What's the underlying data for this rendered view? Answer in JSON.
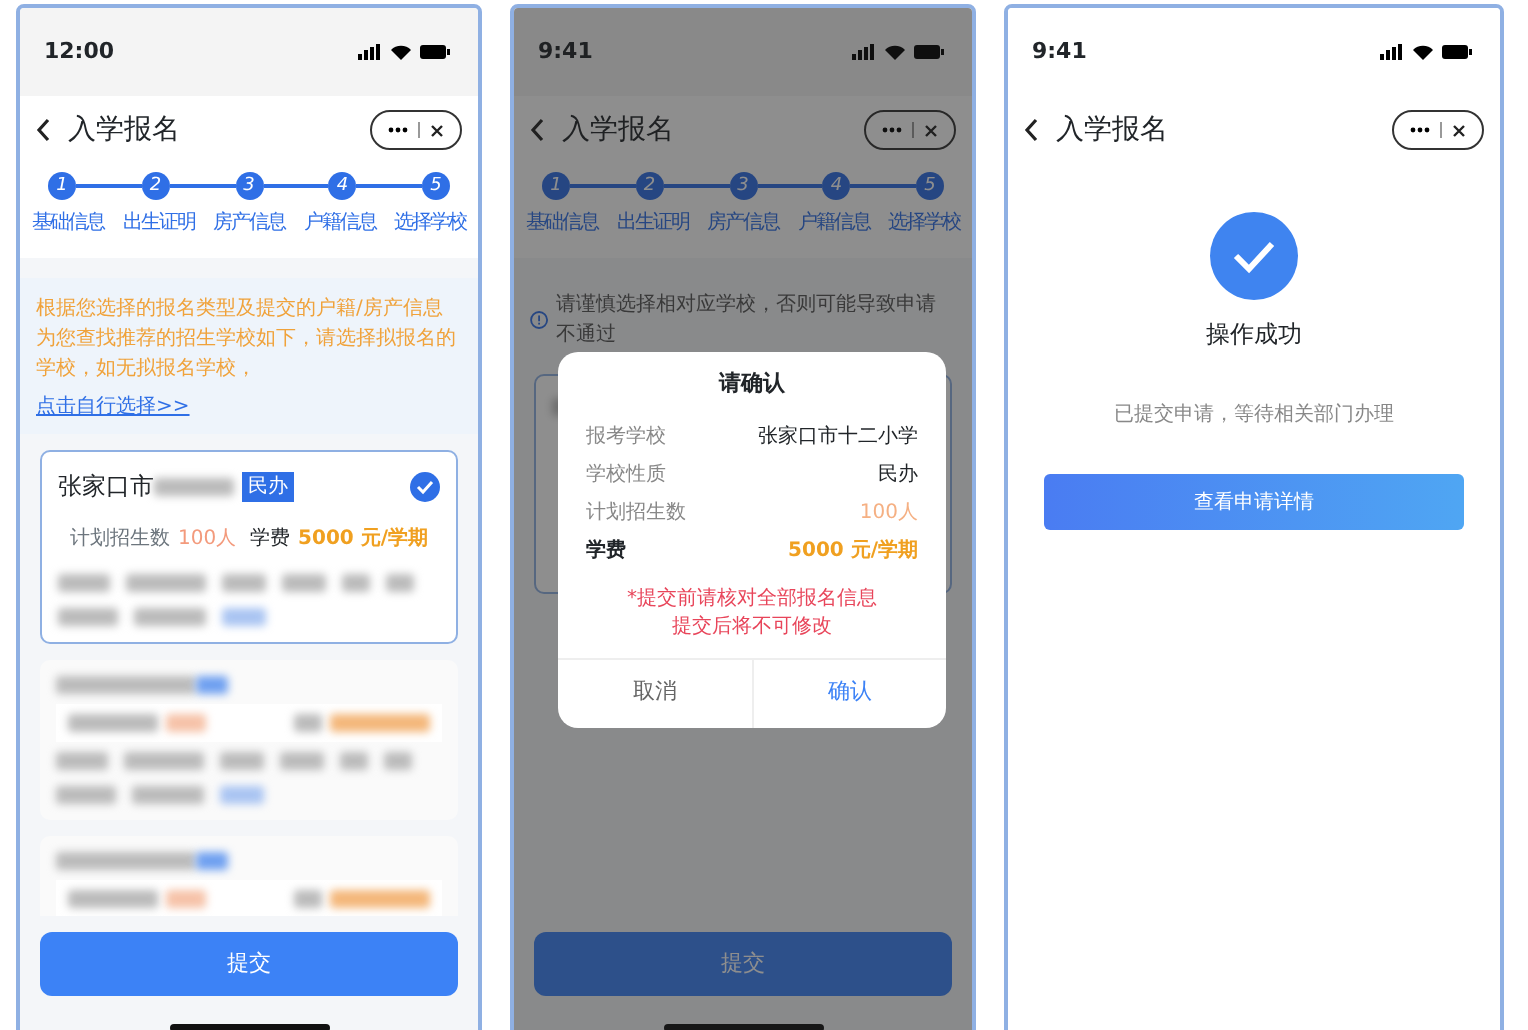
{
  "screen_select": {
    "status_bar": {
      "time": "12:00"
    },
    "nav": {
      "title": "入学报名"
    },
    "steps": [
      {
        "number": "1",
        "label": "基础信息"
      },
      {
        "number": "2",
        "label": "出生证明"
      },
      {
        "number": "3",
        "label": "房产信息"
      },
      {
        "number": "4",
        "label": "户籍信息"
      },
      {
        "number": "5",
        "label": "选择学校"
      }
    ],
    "notice": {
      "text": "根据您选择的报名类型及提交的户籍/房产信息为您查找推荐的招生学校如下，请选择拟报名的学校，如无拟报名学校，",
      "link": "点击自行选择>>"
    },
    "schools": [
      {
        "kind": "visible",
        "name": "张家口市",
        "badge": "民办",
        "selected": true,
        "enrollment_label": "计划招生数",
        "enrollment": "100人",
        "fee_label": "学费",
        "fee": "5000 元/学期"
      },
      {
        "kind": "redacted",
        "selected": false
      },
      {
        "kind": "redacted",
        "selected": false
      }
    ],
    "submit_button": "提交"
  },
  "screen_confirm": {
    "status_bar": {
      "time": "9:41"
    },
    "nav": {
      "title": "入学报名"
    },
    "steps": [
      {
        "number": "1",
        "label": "基础信息"
      },
      {
        "number": "2",
        "label": "出生证明"
      },
      {
        "number": "3",
        "label": "房产信息"
      },
      {
        "number": "4",
        "label": "户籍信息"
      },
      {
        "number": "5",
        "label": "选择学校"
      }
    ],
    "notice": {
      "text": "请谨慎选择相对应学校，否则可能导致申请不通过"
    },
    "school": {
      "selected": true
    },
    "dialog": {
      "title": "请确认",
      "rows": [
        {
          "kind": "plain",
          "label": "报考学校",
          "value": "张家口市十二小学"
        },
        {
          "kind": "plain",
          "label": "学校性质",
          "value": "民办"
        },
        {
          "kind": "count",
          "label": "计划招生数",
          "value": "100人"
        },
        {
          "kind": "fee",
          "label": "学费",
          "value": "5000 元/学期"
        }
      ],
      "warning": [
        "*提交前请核对全部报名信息",
        "提交后将不可修改"
      ],
      "cancel": "取消",
      "confirm": "确认"
    },
    "submit_button": "提交"
  },
  "screen_success": {
    "status_bar": {
      "time": "9:41"
    },
    "nav": {
      "title": "入学报名"
    },
    "result_title": "操作成功",
    "message": "已提交申请，等待相关部门办理",
    "details_button": "查看申请详情"
  }
}
